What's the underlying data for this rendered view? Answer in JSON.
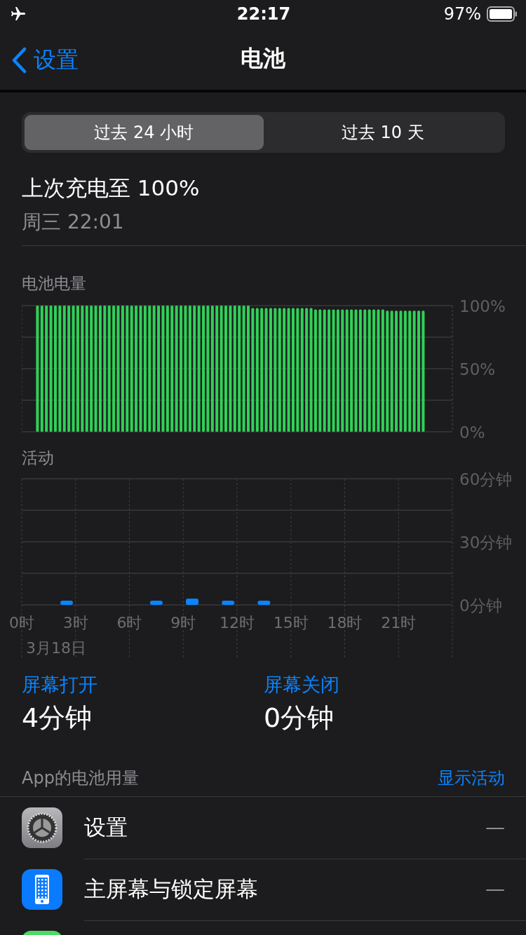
{
  "status_bar": {
    "time": "22:17",
    "battery_text": "97%",
    "airplane_mode": true
  },
  "nav": {
    "back_label": "设置",
    "title": "电池"
  },
  "segments": [
    {
      "label": "过去 24 小时",
      "selected": true
    },
    {
      "label": "过去 10 天",
      "selected": false
    }
  ],
  "last_charge": {
    "title": "上次充电至 100%",
    "time": "周三 22:01"
  },
  "battery_chart": {
    "chart_data": {
      "type": "bar",
      "title": "电池电量",
      "ylim": [
        0,
        100
      ],
      "yticks": [
        {
          "value": 0,
          "label": "0%"
        },
        {
          "value": 50,
          "label": "50%"
        },
        {
          "value": 100,
          "label": "100%"
        }
      ],
      "values": [
        null,
        null,
        null,
        100,
        100,
        100,
        100,
        100,
        100,
        100,
        100,
        100,
        100,
        100,
        100,
        100,
        100,
        100,
        100,
        100,
        100,
        100,
        100,
        100,
        100,
        100,
        100,
        100,
        100,
        100,
        100,
        100,
        100,
        100,
        100,
        100,
        100,
        100,
        100,
        100,
        100,
        100,
        100,
        100,
        100,
        100,
        100,
        100,
        100,
        100,
        100,
        98,
        98,
        98,
        98,
        98,
        98,
        98,
        98,
        98,
        98,
        98,
        98,
        98,
        98,
        97,
        97,
        97,
        97,
        97,
        97,
        97,
        97,
        97,
        97,
        97,
        97,
        97,
        97,
        97,
        97,
        96,
        96,
        96,
        96,
        96,
        96,
        96,
        96,
        96,
        null,
        null,
        null,
        null,
        null,
        null
      ]
    }
  },
  "activity_chart": {
    "date_label": "3月18日",
    "chart_data": {
      "type": "bar",
      "title": "活动",
      "ylim": [
        0,
        60
      ],
      "yticks": [
        {
          "value": 0,
          "label": "0分钟"
        },
        {
          "value": 30,
          "label": "30分钟"
        },
        {
          "value": 60,
          "label": "60分钟"
        }
      ],
      "xlim": [
        0,
        24
      ],
      "grid": true,
      "x": [
        2.5,
        7.5,
        9.5,
        11.5,
        13.5
      ],
      "xticks": [
        {
          "value": 0,
          "label": "0时"
        },
        {
          "value": 3,
          "label": "3时"
        },
        {
          "value": 6,
          "label": "6时"
        },
        {
          "value": 9,
          "label": "9时"
        },
        {
          "value": 12,
          "label": "12时"
        },
        {
          "value": 15,
          "label": "15时"
        },
        {
          "value": 18,
          "label": "18时"
        },
        {
          "value": 21,
          "label": "21时"
        }
      ],
      "values": [
        2,
        2,
        3,
        2,
        2
      ]
    }
  },
  "screen_stats": [
    {
      "label": "屏幕打开",
      "value": "4分钟"
    },
    {
      "label": "屏幕关闭",
      "value": "0分钟"
    }
  ],
  "app_usage": {
    "title": "App的电池用量",
    "action": "显示活动",
    "apps": [
      {
        "kind": "gear",
        "name": "设置",
        "value": "—"
      },
      {
        "kind": "phone",
        "name": "主屏幕与锁定屏幕",
        "value": "—"
      },
      {
        "kind": "app"
      }
    ]
  }
}
